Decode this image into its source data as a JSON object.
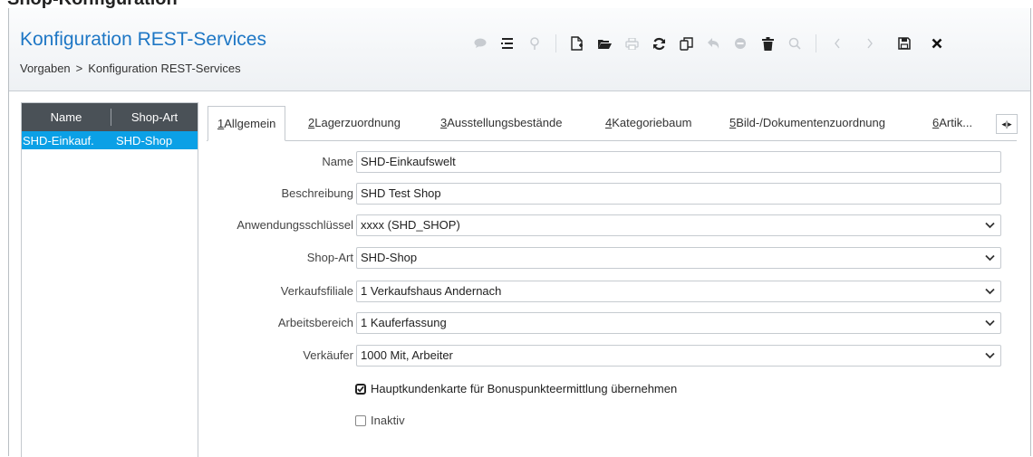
{
  "top_partial_title": "Shop-Konfiguration",
  "header": {
    "title": "Konfiguration REST-Services",
    "breadcrumb": {
      "parent": "Vorgaben",
      "separator": ">",
      "current": "Konfiguration REST-Services"
    }
  },
  "toolbar": {
    "icons": [
      "comment-icon",
      "list-icon",
      "pin-icon",
      "new-document-icon",
      "folder-open-icon",
      "print-icon",
      "refresh-icon",
      "copy-icon",
      "undo-icon",
      "minus-icon",
      "delete-icon",
      "search-icon",
      "prev-icon",
      "next-icon",
      "save-icon",
      "close-icon"
    ]
  },
  "list": {
    "columns": [
      "Name",
      "Shop-Art"
    ],
    "rows": [
      {
        "name": "SHD-Einkauf.",
        "type": "SHD-Shop"
      }
    ]
  },
  "tabs": [
    {
      "num": "1",
      "label": " Allgemein"
    },
    {
      "num": "2",
      "label": " Lagerzuordnung"
    },
    {
      "num": "3",
      "label": " Ausstellungsbestände"
    },
    {
      "num": "4",
      "label": " Kategoriebaum"
    },
    {
      "num": "5",
      "label": " Bild-/Dokumentenzuordnung"
    },
    {
      "num": "6",
      "label": " Artik..."
    }
  ],
  "tab_scroll": "◂|▸",
  "form": {
    "name": {
      "label": "Name",
      "value": "SHD-Einkaufswelt"
    },
    "beschreibung": {
      "label": "Beschreibung",
      "value": "SHD Test Shop"
    },
    "anwendungsschluessel": {
      "label": "Anwendungsschlüssel",
      "value": "xxxx (SHD_SHOP)"
    },
    "shopart": {
      "label": "Shop-Art",
      "value": "SHD-Shop"
    },
    "verkaufsfiliale": {
      "label": "Verkaufsfiliale",
      "value": "1 Verkaufshaus Andernach"
    },
    "arbeitsbereich": {
      "label": "Arbeitsbereich",
      "value": "1 Kauferfassung"
    },
    "verkaeufer": {
      "label": "Verkäufer",
      "value": "1000 Mit, Arbeiter"
    },
    "hauptkundenkarte": {
      "label": "Hauptkundenkarte für Bonuspunkteermittlung übernehmen",
      "checked": true
    },
    "inaktiv": {
      "label": "Inaktiv",
      "checked": false
    }
  },
  "colors": {
    "accent": "#1e77c5",
    "selection": "#0ba0e6",
    "list_header": "#4a5157"
  }
}
